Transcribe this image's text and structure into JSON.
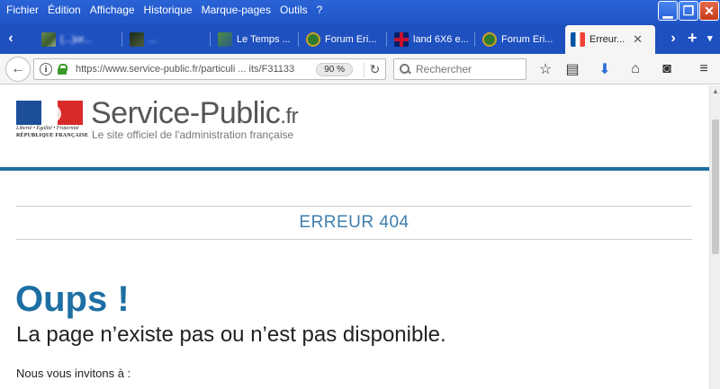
{
  "menu": {
    "items": [
      {
        "label": "Fichier"
      },
      {
        "label": "Édition"
      },
      {
        "label": "Affichage"
      },
      {
        "label": "Historique"
      },
      {
        "label": "Marque-pages"
      },
      {
        "label": "Outils"
      },
      {
        "label": "?"
      }
    ]
  },
  "tabs": [
    {
      "label": "(...)or...",
      "icon": "photo-favicon",
      "blurred": true
    },
    {
      "label": "...",
      "icon": "dark-favicon",
      "blurred": true
    },
    {
      "label": "Le Temps ...",
      "icon": "weather-favicon"
    },
    {
      "label": "Forum Eri...",
      "icon": "forum-favicon"
    },
    {
      "label": "land 6X6 e...",
      "icon": "uk-flag-favicon"
    },
    {
      "label": "Forum Eri...",
      "icon": "forum-favicon"
    },
    {
      "label": "Erreur...",
      "icon": "french-flag-favicon",
      "active": true
    }
  ],
  "nav": {
    "url": "https://www.service-public.fr/particuli ... its/F31133",
    "zoom": "90 %",
    "search_placeholder": "Rechercher"
  },
  "page": {
    "devise": "Liberté • Égalité • Fraternité",
    "republique": "RÉPUBLIQUE FRANÇAISE",
    "site_name": "Service-Public",
    "site_tld": ".fr",
    "tagline": "Le site officiel de l'administration française",
    "error_code": "ERREUR 404",
    "headline": "Oups !",
    "subtitle": "La page n’existe pas ou n’est pas disponible.",
    "invite": "Nous vous invitons à :"
  },
  "colors": {
    "accent": "#1d6fa3",
    "error_text": "#3f7fae",
    "titlebar": "#1f55c8"
  }
}
